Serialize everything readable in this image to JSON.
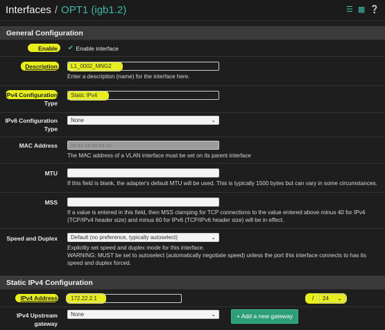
{
  "header": {
    "breadcrumb_root": "Interfaces",
    "separator": "/",
    "breadcrumb_current": "OPT1 (igb1.2)",
    "icons": [
      "sliders-icon",
      "chart-icon",
      "help-icon"
    ]
  },
  "general": {
    "title": "General Configuration",
    "enable": {
      "label": "Enable",
      "checkbox_label": "Enable interface",
      "checked": true
    },
    "description": {
      "label": "Description",
      "value": "L1_0002_MNG2",
      "help": "Enter a description (name) for the interface here."
    },
    "ipv4_config": {
      "label1": "IPv4 Configuration",
      "label2": "Type",
      "value": "Static IPv4"
    },
    "ipv6_config": {
      "label1": "IPv6 Configuration",
      "label2": "Type",
      "value": "None"
    },
    "mac": {
      "label": "MAC Address",
      "placeholder": "xx:xx:xx:xx:xx:xx",
      "help": "The MAC address of a VLAN interface must be set on its parent interface"
    },
    "mtu": {
      "label": "MTU",
      "value": "",
      "help": "If this field is blank, the adapter's default MTU will be used. This is typically 1500 bytes but can vary in some circumstances."
    },
    "mss": {
      "label": "MSS",
      "value": "",
      "help1": "If a value is entered in this field, then MSS clamping for TCP connections to the value entered above minus 40 for IPv4",
      "help2": "(TCP/IPv4 header size) and minus 60 for IPv6 (TCP/IPv6 header size) will be in effect."
    },
    "speed": {
      "label": "Speed and Duplex",
      "value": "Default (no preference, typically autoselect)",
      "help1": "Explicitly set speed and duplex mode for this interface.",
      "help2": "WARNING: MUST be set to autoselect (automatically negotiate speed) unless the port this interface connects to has its",
      "help3": "speed and duplex forced."
    }
  },
  "static_ipv4": {
    "title": "Static IPv4 Configuration",
    "address": {
      "label": "IPv4 Address",
      "value": "172.22.2.1",
      "slash": "/",
      "cidr": "24"
    },
    "gateway": {
      "label1": "IPv4 Upstream",
      "label2": "gateway",
      "value": "None",
      "add_button": "+ Add a new gateway"
    }
  },
  "colors": {
    "accent": "#3fb9a4",
    "highlight": "#e8ee1e",
    "button_green": "#2e9e78",
    "background": "#1e1e1e",
    "section_bar": "#3a3a3a"
  }
}
